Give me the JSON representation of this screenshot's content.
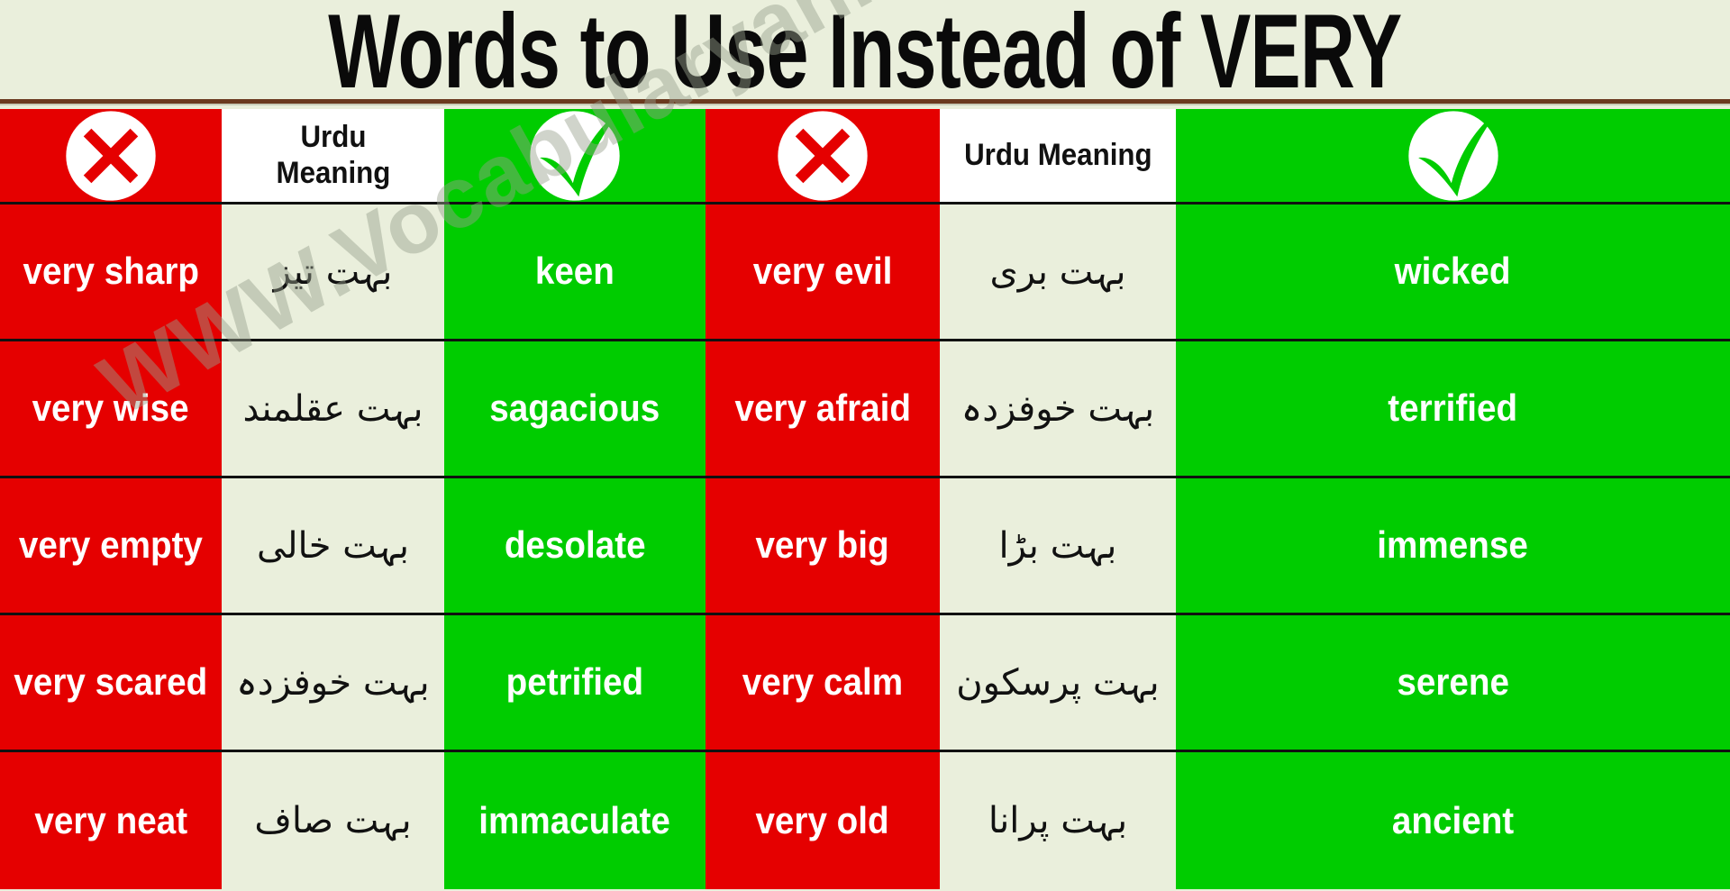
{
  "page": {
    "title": "Words to Use Instead of VERY",
    "watermark": "WWW.Vocabularyan.com",
    "colors": {
      "background": "#eaefdc",
      "avoid_red": "#e50000",
      "use_green": "#00cc00",
      "urdu_cell": "#eaefdc",
      "header_urdu_cell": "#ffffff",
      "title_rule": "#6b3a1f",
      "text_light": "#ffffff",
      "text_dark": "#111111",
      "watermark": "#96a08c"
    }
  },
  "table": {
    "headers": {
      "group1": {
        "avoid_icon": "red-cross-icon",
        "urdu_label": "Urdu\nMeaning",
        "urdu_label_line1": "Urdu",
        "urdu_label_line2": "Meaning",
        "use_icon": "green-check-icon"
      },
      "group2": {
        "avoid_icon": "red-cross-icon",
        "urdu_label": "Urdu Meaning",
        "use_icon": "green-check-icon"
      }
    },
    "rows": [
      {
        "avoid1": "very sharp",
        "urdu1": "بہت تیز",
        "use1": "keen",
        "avoid2": "very evil",
        "urdu2": "بہت بری",
        "use2": "wicked"
      },
      {
        "avoid1": "very wise",
        "urdu1": "بہت عقلمند",
        "use1": "sagacious",
        "avoid2": "very afraid",
        "urdu2": "بہت خوفزدہ",
        "use2": "terrified"
      },
      {
        "avoid1": "very empty",
        "urdu1": "بہت خالی",
        "use1": "desolate",
        "avoid2": "very big",
        "urdu2": "بہت بڑا",
        "use2": "immense"
      },
      {
        "avoid1": "very scared",
        "urdu1": "بہت خوفزدہ",
        "use1": "petrified",
        "avoid2": "very calm",
        "urdu2": "بہت پرسکون",
        "use2": "serene"
      },
      {
        "avoid1": "very neat",
        "urdu1": "بہت صاف",
        "use1": "immaculate",
        "avoid2": "very old",
        "urdu2": "بہت پرانا",
        "use2": "ancient"
      }
    ]
  }
}
